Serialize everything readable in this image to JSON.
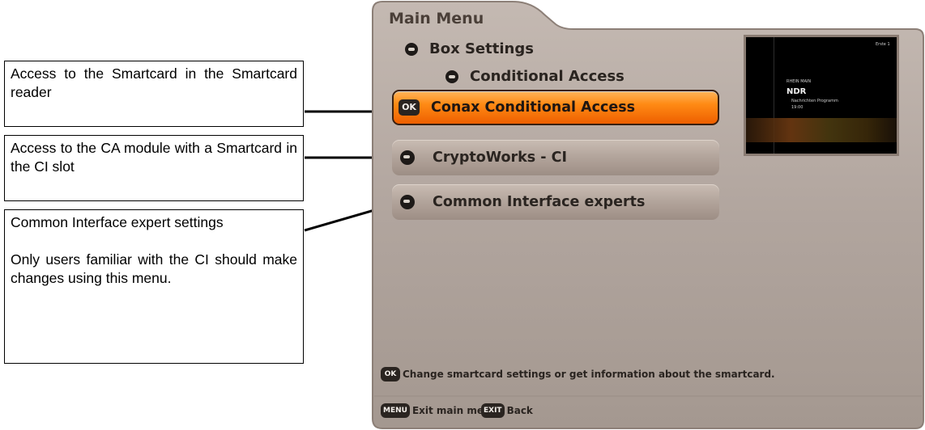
{
  "annotations": {
    "smartcard_reader": "Access to the Smartcard in the Smartcard reader",
    "ca_module": "Access to the CA module with a Smartcard in the CI slot",
    "ci_expert": "Common Interface expert settings",
    "ci_warning": "Only users familiar with the CI should make changes using this menu."
  },
  "osd": {
    "title": "Main Menu",
    "breadcrumb": [
      "Box Settings",
      "Conditional Access"
    ],
    "menu_items": [
      {
        "label": "Conax Conditional Access",
        "selected": true,
        "badge": "OK"
      },
      {
        "label": "CryptoWorks - CI",
        "selected": false
      },
      {
        "label": "Common Interface experts",
        "selected": false
      }
    ],
    "preview": {
      "channel_logo": "NDR",
      "corner_text": "Erste 1",
      "small_text_1": "RHEIN MAIN",
      "small_text_2": "Nachrichten Programm",
      "small_text_3": "19:00"
    },
    "hint": {
      "key": "OK",
      "text": "Change smartcard settings or get information about the smartcard."
    },
    "footer": [
      {
        "key": "MENU",
        "text": "Exit main menu"
      },
      {
        "key": "EXIT",
        "text": "Back"
      }
    ]
  },
  "colors": {
    "panel_bg": "#b2a69f",
    "selected_item": "#ff8a14",
    "normal_item": "#b4a69d"
  },
  "icons": {
    "breadcrumb": "navigate-circle-icon",
    "menu_item": "navigate-circle-icon",
    "ok_key": "ok-key-icon",
    "menu_key": "menu-key-icon",
    "exit_key": "exit-key-icon"
  }
}
